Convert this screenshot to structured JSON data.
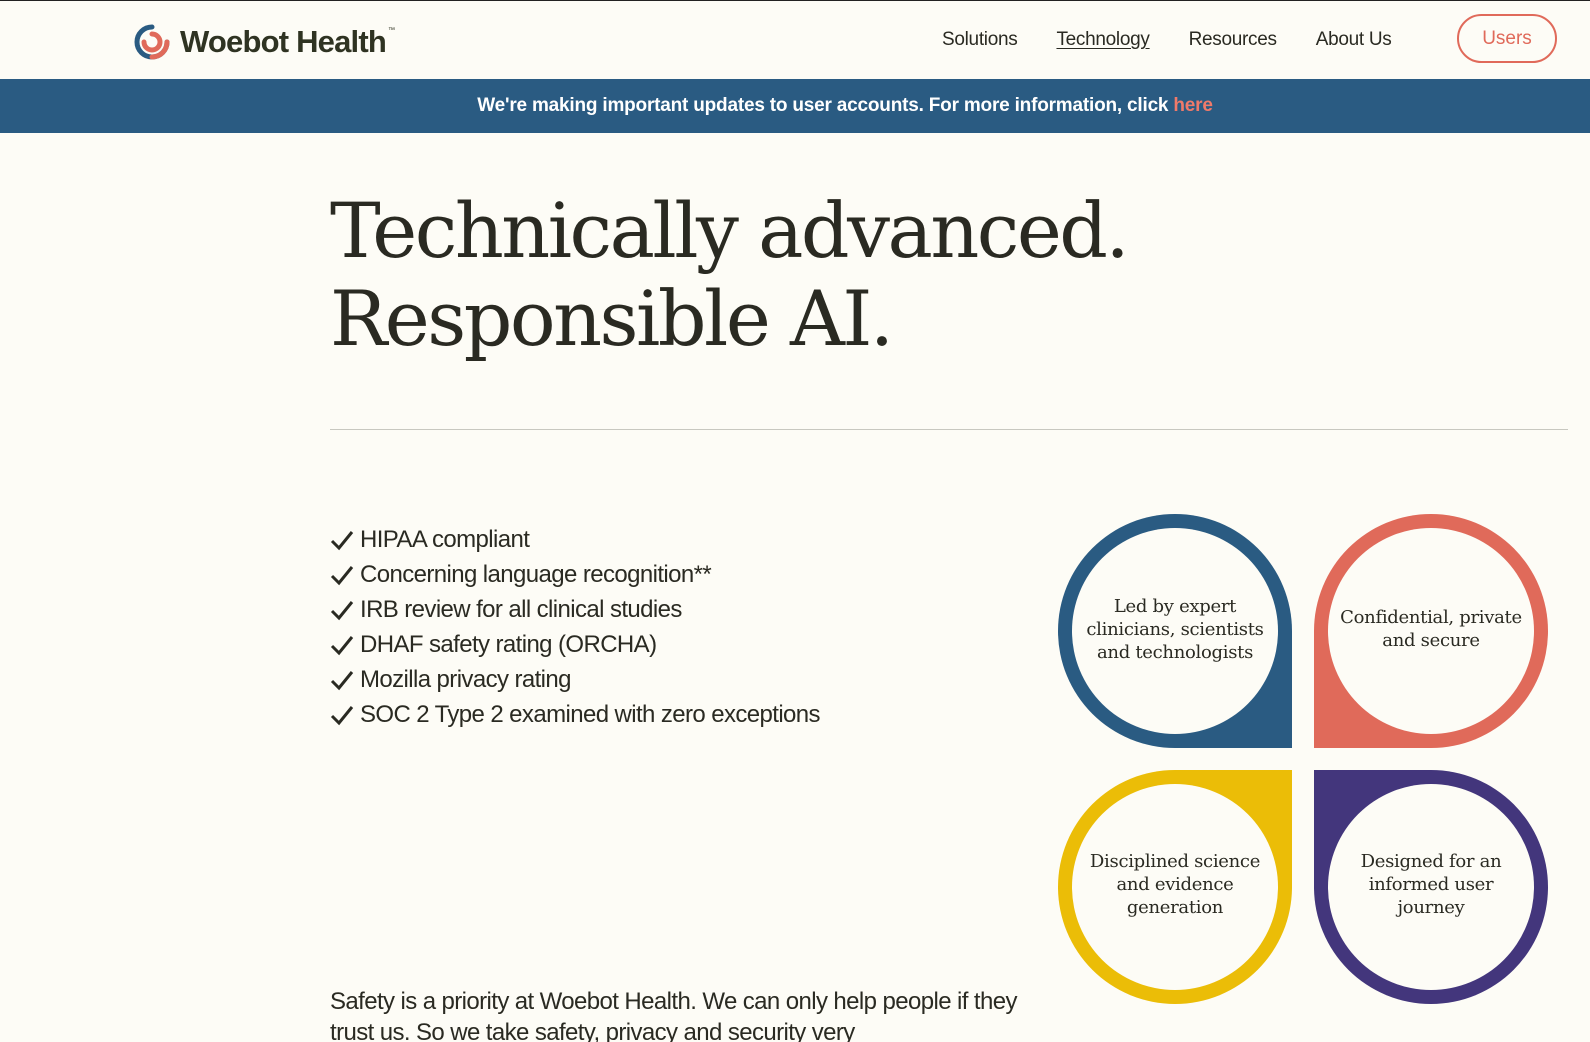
{
  "header": {
    "brand": "Woebot Health",
    "trademark": "™",
    "nav": [
      {
        "label": "Solutions"
      },
      {
        "label": "Technology"
      },
      {
        "label": "Resources"
      },
      {
        "label": "About Us"
      }
    ],
    "users_button": "Users"
  },
  "banner": {
    "text": "We're making important updates to user accounts. For more information, click",
    "link_label": "here"
  },
  "main": {
    "headline": "Technically advanced. Responsible AI.",
    "checklist": [
      "HIPAA compliant",
      "Concerning language recognition**",
      "IRB review for all clinical studies",
      "DHAF safety rating (ORCHA)",
      "Mozilla privacy rating",
      "SOC 2 Type 2 examined with zero exceptions"
    ],
    "petals": [
      {
        "label": "Led by expert clinicians, scientists and technologists",
        "color": "#2a5b82"
      },
      {
        "label": "Confidential, private and secure",
        "color": "#e06a5a"
      },
      {
        "label": "Disciplined science and evidence generation",
        "color": "#ebbd07"
      },
      {
        "label": "Designed for an informed user journey",
        "color": "#43367c"
      }
    ],
    "body": "Safety is a priority at Woebot Health. We can only help people if they trust us. So we take safety, privacy and security very"
  },
  "colors": {
    "background": "#fdfcf6",
    "banner": "#2a5b82",
    "accent": "#e06a5a",
    "text": "#2a2a22"
  }
}
